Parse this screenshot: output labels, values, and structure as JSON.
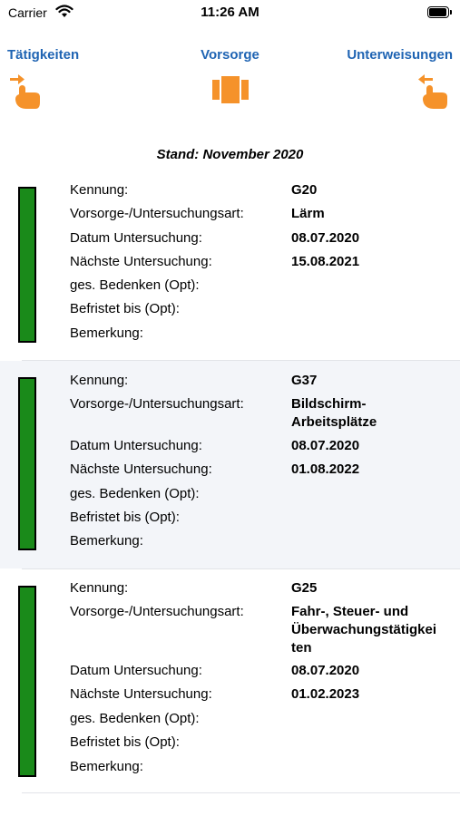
{
  "status_bar": {
    "carrier": "Carrier",
    "time": "11:26 AM"
  },
  "nav": {
    "left_label": "Tätigkeiten",
    "center_label": "Vorsorge",
    "right_label": "Unterweisungen",
    "accent_color": "#1f64b3",
    "icon_color": "#f5922a"
  },
  "stand": "Stand: November 2020",
  "labels": {
    "kennung": "Kennung:",
    "art": "Vorsorge-/Untersuchungsart:",
    "datum": "Datum Untersuchung:",
    "naechste": "Nächste Untersuchung:",
    "bedenken": "ges. Bedenken (Opt):",
    "befristet": "Befristet bis (Opt):",
    "bemerkung": "Bemerkung:"
  },
  "records": [
    {
      "kennung": "G20",
      "art_lines": [
        "Lärm"
      ],
      "datum": "08.07.2020",
      "naechste": "15.08.2021",
      "bedenken": "",
      "befristet": "",
      "bemerkung": "",
      "status_color": "#1a8a1a"
    },
    {
      "kennung": "G37",
      "art_lines": [
        "Bildschirm-",
        "Arbeitsplätze"
      ],
      "datum": "08.07.2020",
      "naechste": "01.08.2022",
      "bedenken": "",
      "befristet": "",
      "bemerkung": "",
      "status_color": "#1a8a1a"
    },
    {
      "kennung": "G25",
      "art_lines": [
        "Fahr-, Steuer- und",
        "Überwachungstätigkei",
        "ten"
      ],
      "datum": "08.07.2020",
      "naechste": "01.02.2023",
      "bedenken": "",
      "befristet": "",
      "bemerkung": "",
      "status_color": "#1a8a1a"
    }
  ]
}
